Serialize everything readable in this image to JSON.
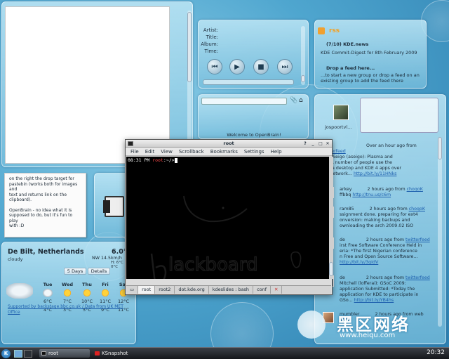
{
  "notes": {
    "text_lines": [
      "on the right the drop target for",
      "pastebin (works both for images and",
      "text and returns link on the",
      "clipboard).",
      "",
      "OpenBrain - no idea what it is",
      "supposed to do, but it's fun to play",
      "with :D"
    ]
  },
  "player": {
    "labels": [
      "Artist:",
      "Title:",
      "Album:",
      "Time:"
    ],
    "buttons": [
      "previous",
      "play",
      "stop",
      "next"
    ]
  },
  "openbrain": {
    "welcome": "Welcome to OpenBrain!"
  },
  "rss": {
    "logo_text": "rss",
    "items": [
      {
        "title": "(7/10) KDE.news",
        "subtitle": "KDE Commit-Digest for 8th February 2009"
      },
      {
        "title": "Drop a feed here...",
        "subtitle": "...to start a new group or drop a feed on an existing group to add the feed there"
      }
    ]
  },
  "weather": {
    "location": "De Bilt, Netherlands",
    "condition": "cloudy",
    "temp": "6.0°C",
    "wind": "NW 14.5km/h",
    "hilo": "H: 6°C L: 0°C",
    "tabs": [
      "5 Days",
      "Details"
    ],
    "days": [
      {
        "day": "Tue",
        "high": "6°C",
        "low": "4°C",
        "icon": "cloud-icon"
      },
      {
        "day": "Wed",
        "high": "7°C",
        "low": "3°C",
        "icon": "sun-cloud-icon"
      },
      {
        "day": "Thu",
        "high": "10°C",
        "low": "5°C",
        "icon": "sun-cloud-icon"
      },
      {
        "day": "Fri",
        "high": "11°C",
        "low": "9°C",
        "icon": "sun-cloud-icon"
      },
      {
        "day": "Sat",
        "high": "12°C",
        "low": "11°C",
        "icon": "sun-cloud-icon"
      }
    ],
    "footer": "Supported by backstage.bbc.co.uk / Data from UK MET Office"
  },
  "twitter": {
    "user": "jospoortvl...",
    "entries": [
      {
        "head": "Over an hour ago from",
        "source": "twitterfeed",
        "lines": [
          "aron Seigo (aseigo): Plasma and",
          "NC: A number of people use the",
          "lasma desktop and KDE 4 apps over",
          "the network..."
        ],
        "link": "http://bit.ly/11HNks"
      },
      {
        "user": "arkey",
        "head": "2 hours ago from",
        "source": "choqoK",
        "lines": [
          "ffbbq"
        ],
        "link": "http://tnu.us/c6m"
      },
      {
        "user": "ram85",
        "head": "2 hours ago from",
        "source": "choqoK",
        "lines": [
          "ssignment done. preparing for ext4",
          "onversion: making backups and",
          "ownloading the arch 2009.02 ISO"
        ],
        "link": ""
      },
      {
        "user": "de",
        "head": "2 hours ago from",
        "source": "twitterfeed",
        "lines": [
          "irst Free Software Conference Held in",
          "eria: *The first Nigerian conference",
          "n Free and Open Source Software..."
        ],
        "link": "http://bit.ly/3gIdV"
      },
      {
        "user": "de",
        "head": "2 hours ago from",
        "source": "twitterfeed",
        "lines": [
          "Mitchell (lofferai): GSoC 2009:",
          "application Submitted: *Today the",
          "application for KDE to participate in",
          "GSo..."
        ],
        "link": "http://bit.ly/YB4hs"
      },
      {
        "user": "mumbler",
        "head": "2 hours ago from web",
        "source": "",
        "lines": [
          "Sile..."
        ],
        "link": ""
      }
    ]
  },
  "konsole": {
    "title": "root",
    "menu": [
      "File",
      "Edit",
      "View",
      "Scrollback",
      "Bookmarks",
      "Settings",
      "Help"
    ],
    "prompt_time": "08:31 PM",
    "prompt_user": "root",
    "prompt_path": ":~/>",
    "tabs": [
      "root",
      "root2",
      "dot.kde.org",
      "kdeslides : bash",
      "conf"
    ]
  },
  "taskbar": {
    "tasks": [
      "root",
      "KSnapshot"
    ],
    "clock": "20:32"
  },
  "watermark": {
    "brand": "黑区网络",
    "url": "www.heiqu.com"
  }
}
